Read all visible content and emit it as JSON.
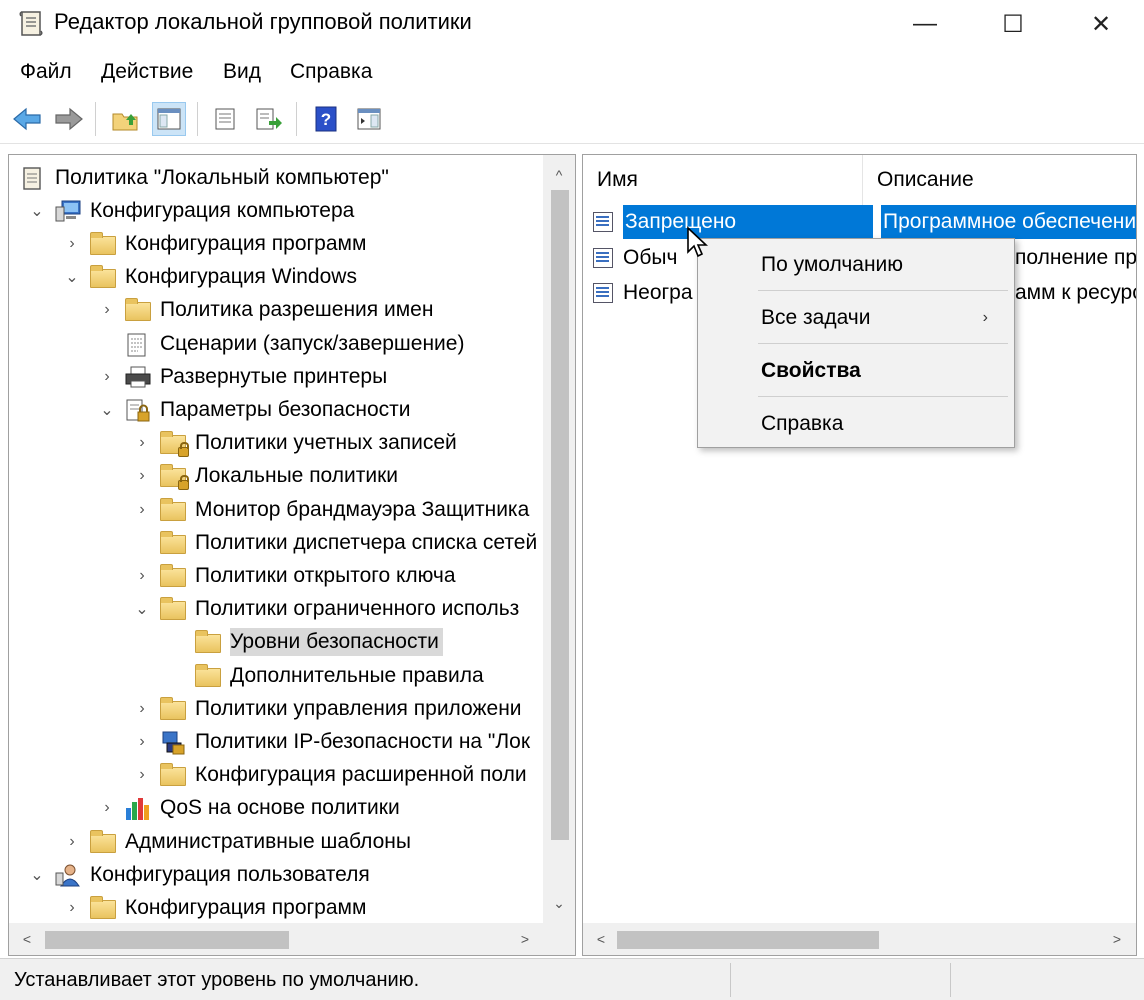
{
  "window": {
    "title": "Редактор локальной групповой политики",
    "icon": "gpedit-icon",
    "minimize_glyph": "—",
    "maximize_glyph": "☐",
    "close_glyph": "✕"
  },
  "menu": [
    "Файл",
    "Действие",
    "Вид",
    "Справка"
  ],
  "toolbar": [
    "back-arrow-icon",
    "forward-arrow-icon",
    "up-folder-icon",
    "show-hide-tree-icon",
    "properties-icon",
    "export-list-icon",
    "help-icon",
    "action-pane-icon"
  ],
  "tree": {
    "items": [
      {
        "label": "Политика \"Локальный компьютер\"",
        "icon": "policy-scroll-icon",
        "chevron": ""
      },
      {
        "label": "Конфигурация компьютера",
        "icon": "computer-icon",
        "chevron": "⌄"
      },
      {
        "label": "Конфигурация программ",
        "icon": "folder-icon",
        "chevron": "›"
      },
      {
        "label": "Конфигурация Windows",
        "icon": "folder-icon",
        "chevron": "⌄"
      },
      {
        "label": "Политика разрешения имен",
        "icon": "folder-icon",
        "chevron": "›"
      },
      {
        "label": "Сценарии (запуск/завершение)",
        "icon": "script-icon",
        "chevron": ""
      },
      {
        "label": "Развернутые принтеры",
        "icon": "printer-icon",
        "chevron": "›"
      },
      {
        "label": "Параметры безопасности",
        "icon": "security-settings-icon",
        "chevron": "⌄"
      },
      {
        "label": "Политики учетных записей",
        "icon": "locked-folder-icon",
        "chevron": "›"
      },
      {
        "label": "Локальные политики",
        "icon": "locked-folder-icon",
        "chevron": "›"
      },
      {
        "label": "Монитор брандмауэра Защитника",
        "icon": "folder-icon",
        "chevron": "›"
      },
      {
        "label": "Политики диспетчера списка сетей",
        "icon": "folder-icon",
        "chevron": ""
      },
      {
        "label": "Политики открытого ключа",
        "icon": "folder-icon",
        "chevron": "›"
      },
      {
        "label": "Политики ограниченного использ",
        "icon": "folder-icon",
        "chevron": "⌄"
      },
      {
        "label": "Уровни безопасности",
        "icon": "folder-icon",
        "chevron": ""
      },
      {
        "label": "Дополнительные правила",
        "icon": "folder-icon",
        "chevron": ""
      },
      {
        "label": "Политики управления приложени",
        "icon": "folder-icon",
        "chevron": "›"
      },
      {
        "label": "Политики IP-безопасности на \"Лок",
        "icon": "ip-security-icon",
        "chevron": "›"
      },
      {
        "label": "Конфигурация расширенной поли",
        "icon": "folder-icon",
        "chevron": "›"
      },
      {
        "label": "QoS на основе политики",
        "icon": "qos-chart-icon",
        "chevron": "›"
      },
      {
        "label": "Административные шаблоны",
        "icon": "folder-icon",
        "chevron": "›"
      },
      {
        "label": "Конфигурация пользователя",
        "icon": "user-icon",
        "chevron": "⌄"
      },
      {
        "label": "Конфигурация программ",
        "icon": "folder-icon",
        "chevron": "›"
      }
    ]
  },
  "list": {
    "columns": [
      "Имя",
      "Описание"
    ],
    "rows": [
      {
        "name": "Запрещено",
        "description": "Программное обеспечени"
      },
      {
        "name": "Обыч",
        "description": "полнение пр"
      },
      {
        "name": "Неогра",
        "description": "амм к ресурс"
      }
    ]
  },
  "context_menu": {
    "items": [
      "По умолчанию",
      "Все задачи",
      "Свойства",
      "Справка"
    ],
    "submenu_arrow": "›"
  },
  "scroll": {
    "up": "^",
    "down": "⌄",
    "left": "<",
    "right": ">"
  },
  "status": {
    "text": "Устанавливает этот уровень по умолчанию."
  },
  "colors": {
    "selection": "#0078d7",
    "tree_selection": "#d9d9d9",
    "folder": "#f3d27a"
  }
}
